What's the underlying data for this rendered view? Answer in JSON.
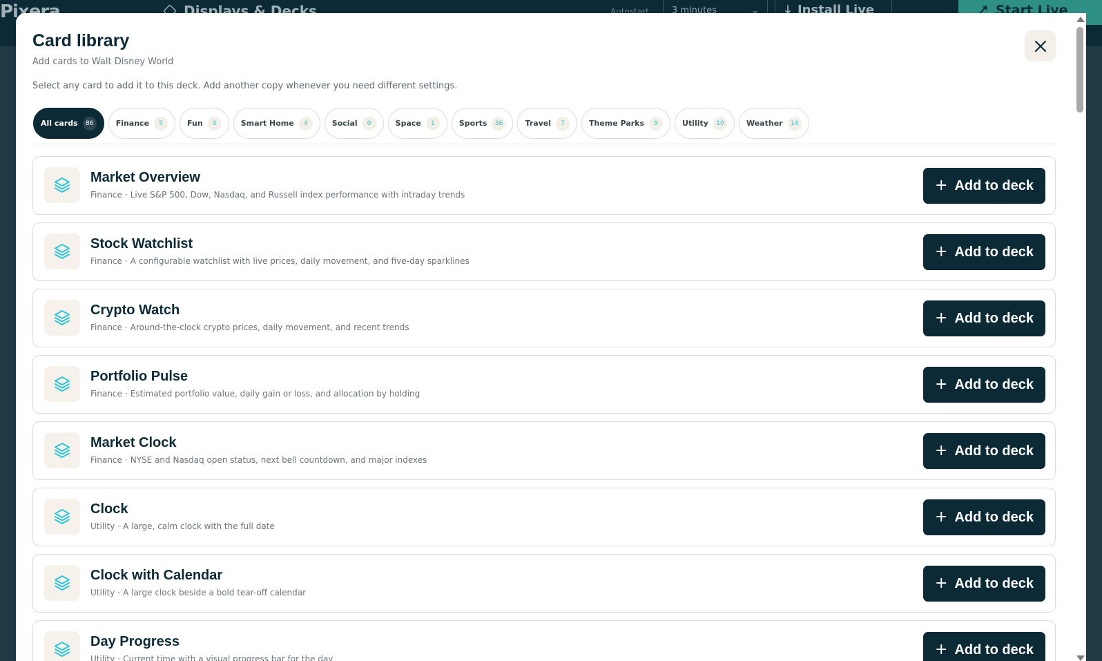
{
  "background": {
    "logo": "Pixera",
    "title": "Displays & Decks",
    "autostart_label": "Autostart",
    "autostart_value": "3 minutes",
    "install_label": "Install Live",
    "live_label": "Start Live here"
  },
  "modal": {
    "title": "Card library",
    "subtitle": "Add cards to Walt Disney World",
    "intro": "Select any card to add it to this deck. Add another copy whenever you need different settings.",
    "close_icon": "close-icon"
  },
  "filters": [
    {
      "label": "All cards",
      "count": "86",
      "active": true
    },
    {
      "label": "Finance",
      "count": "5"
    },
    {
      "label": "Fun",
      "count": "0"
    },
    {
      "label": "Smart Home",
      "count": "4"
    },
    {
      "label": "Social",
      "count": "0"
    },
    {
      "label": "Space",
      "count": "1"
    },
    {
      "label": "Sports",
      "count": "36"
    },
    {
      "label": "Travel",
      "count": "7"
    },
    {
      "label": "Theme Parks",
      "count": "9"
    },
    {
      "label": "Utility",
      "count": "10"
    },
    {
      "label": "Weather",
      "count": "14"
    }
  ],
  "add_button_label": "Add to deck",
  "cards": [
    {
      "title": "Market Overview",
      "category": "Finance",
      "description": "Live S&P 500, Dow, Nasdaq, and Russell index performance with intraday trends",
      "icon": "layers-icon"
    },
    {
      "title": "Stock Watchlist",
      "category": "Finance",
      "description": "A configurable watchlist with live prices, daily movement, and five-day sparklines",
      "icon": "layers-icon"
    },
    {
      "title": "Crypto Watch",
      "category": "Finance",
      "description": "Around-the-clock crypto prices, daily movement, and recent trends",
      "icon": "layers-icon"
    },
    {
      "title": "Portfolio Pulse",
      "category": "Finance",
      "description": "Estimated portfolio value, daily gain or loss, and allocation by holding",
      "icon": "layers-icon"
    },
    {
      "title": "Market Clock",
      "category": "Finance",
      "description": "NYSE and Nasdaq open status, next bell countdown, and major indexes",
      "icon": "layers-icon"
    },
    {
      "title": "Clock",
      "category": "Utility",
      "description": "A large, calm clock with the full date",
      "icon": "layers-icon"
    },
    {
      "title": "Clock with Calendar",
      "category": "Utility",
      "description": "A large clock beside a bold tear-off calendar",
      "icon": "layers-icon"
    },
    {
      "title": "Day Progress",
      "category": "Utility",
      "description": "Current time with a visual progress bar for the day",
      "icon": "layers-icon"
    }
  ],
  "colors": {
    "primary": "#0c2a36",
    "accent": "#2bc6d8",
    "icon_bg": "#f6f1ea"
  }
}
